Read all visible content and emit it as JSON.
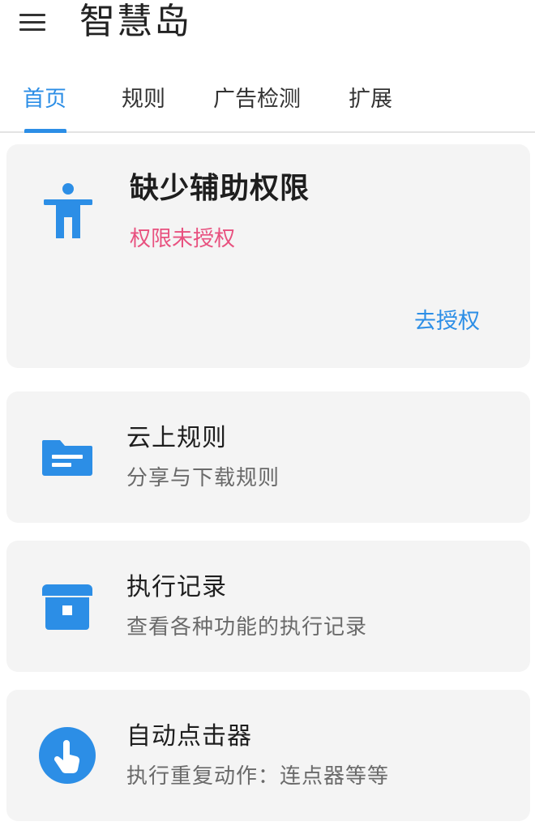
{
  "app": {
    "title": "智慧岛"
  },
  "tabs": [
    {
      "label": "首页",
      "active": true
    },
    {
      "label": "规则",
      "active": false
    },
    {
      "label": "广告检测",
      "active": false
    },
    {
      "label": "扩展",
      "active": false
    }
  ],
  "permission_card": {
    "title": "缺少辅助权限",
    "status": "权限未授权",
    "action": "去授权",
    "icon": "accessibility-icon"
  },
  "cards": [
    {
      "title": "云上规则",
      "subtitle": "分享与下载规则",
      "icon": "folder-icon"
    },
    {
      "title": "执行记录",
      "subtitle": "查看各种功能的执行记录",
      "icon": "archive-icon"
    },
    {
      "title": "自动点击器",
      "subtitle": "执行重复动作：连点器等等",
      "icon": "touch-icon"
    }
  ],
  "colors": {
    "accent": "#2c8ee6",
    "warning": "#e8517f",
    "card_bg": "#f4f4f4"
  }
}
